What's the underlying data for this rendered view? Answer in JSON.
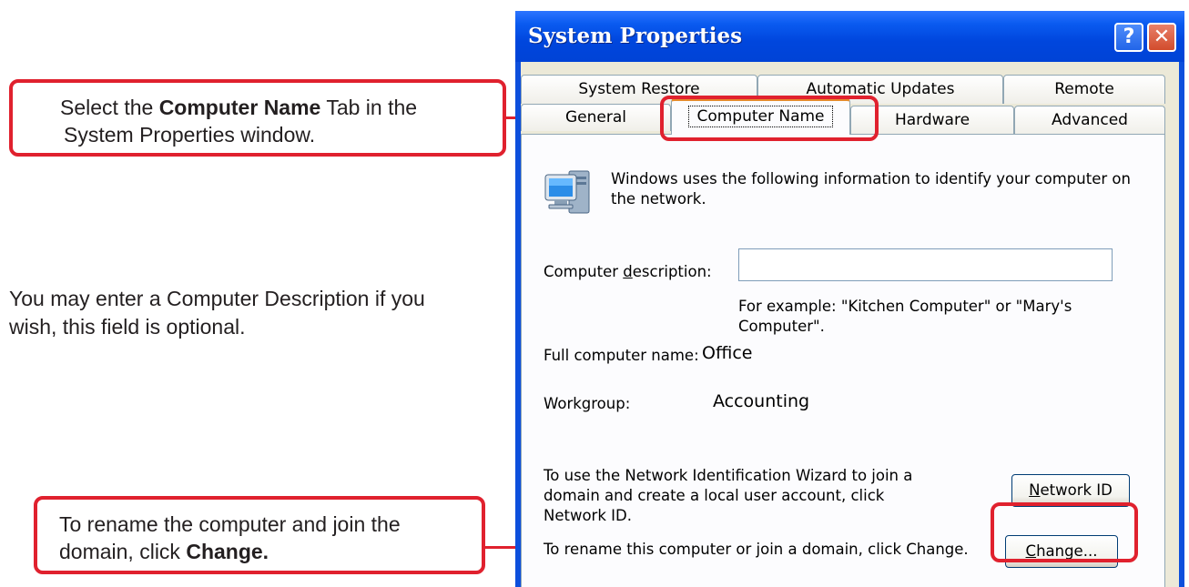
{
  "annotations": {
    "tab_hint_pre": "Select the ",
    "tab_hint_bold": "Computer Name",
    "tab_hint_post": " Tab in the",
    "tab_hint_line2": "System Properties window.",
    "description_note_line1": "You may enter a Computer Description if you",
    "description_note_line2": "wish, this field is optional.",
    "change_hint_line1": "To rename the computer and join the",
    "change_hint_pre": "domain, click ",
    "change_hint_bold": "Change."
  },
  "window": {
    "title": "System Properties",
    "help_glyph": "?",
    "close_glyph": "✕"
  },
  "tabs": {
    "row1": [
      "System Restore",
      "Automatic Updates",
      "Remote"
    ],
    "row2": [
      "General",
      "Computer Name",
      "Hardware",
      "Advanced"
    ],
    "selected": "Computer Name"
  },
  "panel": {
    "icon": "computer-icon",
    "intro": "Windows uses the following information to identify your computer on the network.",
    "description_label": "Computer description:",
    "description_value": "",
    "example": "For example: \"Kitchen Computer\" or \"Mary's Computer\".",
    "full_name_label": "Full computer name:",
    "full_name_value": "Office",
    "workgroup_label": "Workgroup:",
    "workgroup_value": "Accounting",
    "network_id_text": "To use the Network Identification Wizard to join a domain and create a local user account, click Network ID.",
    "network_id_button": "Network ID",
    "rename_text": "To rename this computer or join a domain, click Change.",
    "change_button": "Change..."
  },
  "colors": {
    "highlight": "#e0212e",
    "titlebar": "#0046dd",
    "dialog_bg": "#ece9d8"
  }
}
